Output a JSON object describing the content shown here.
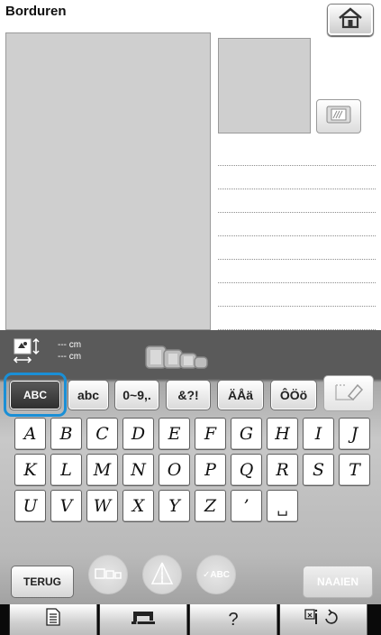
{
  "header": {
    "title": "Borduren"
  },
  "size": {
    "width": "--- cm",
    "height": "--- cm"
  },
  "tabs": [
    {
      "label": "ABC"
    },
    {
      "label": "abc"
    },
    {
      "label": "0~9,."
    },
    {
      "label": "&?!"
    },
    {
      "label": "ÄÅä"
    },
    {
      "label": "ÔÖö"
    }
  ],
  "keyboard": {
    "rows": [
      [
        "A",
        "B",
        "C",
        "D",
        "E",
        "F",
        "G",
        "H",
        "I",
        "J"
      ],
      [
        "K",
        "L",
        "M",
        "N",
        "O",
        "P",
        "Q",
        "R",
        "S",
        "T"
      ],
      [
        "U",
        "V",
        "W",
        "X",
        "Y",
        "Z",
        "’",
        "␣"
      ]
    ]
  },
  "actions": {
    "back_label": "TERUG",
    "sew_label": "NAAIEN",
    "check_label": "✓ABC"
  },
  "footer": {
    "help_label": "?"
  },
  "colors": {
    "highlight": "#1a8fd6",
    "panel_dark": "#5a5a5a"
  }
}
